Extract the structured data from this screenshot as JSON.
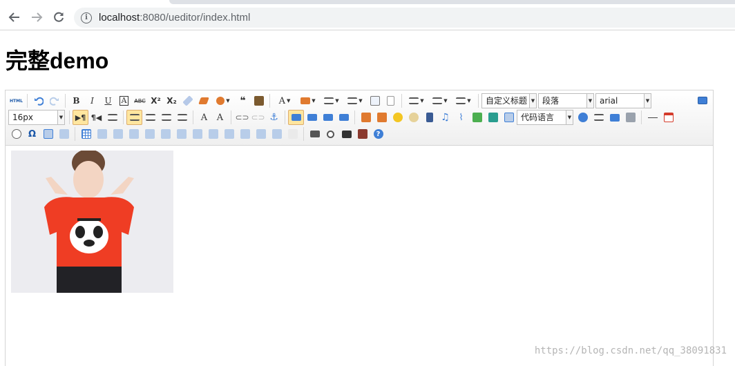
{
  "browser": {
    "url_host": "localhost",
    "url_path": ":8080/ueditor/index.html"
  },
  "page": {
    "title": "完整demo"
  },
  "toolbar": {
    "source_label": "HTML",
    "bold_label": "B",
    "italic_label": "I",
    "underline_label": "U",
    "fontborder_label": "A",
    "strike_label": "ABC",
    "superscript_label": "X²",
    "subscript_label": "X₂",
    "forecolor_label": "A",
    "fontsize_label": "A",
    "fontsize_alt_label": "A",
    "omega_label": "Ω",
    "help_label": "?",
    "customstyle": "自定义标题",
    "paragraph": "段落",
    "fontfamily": "arial",
    "fontsize": "16px",
    "codelang": "代码语言"
  },
  "watermark": {
    "text": "https://blog.csdn.net/qq_38091831"
  },
  "colors": {
    "toolbar_active_bg": "#ffe69f",
    "toolbar_border": "#d4d4d4",
    "help_blue": "#3f7fd6"
  }
}
